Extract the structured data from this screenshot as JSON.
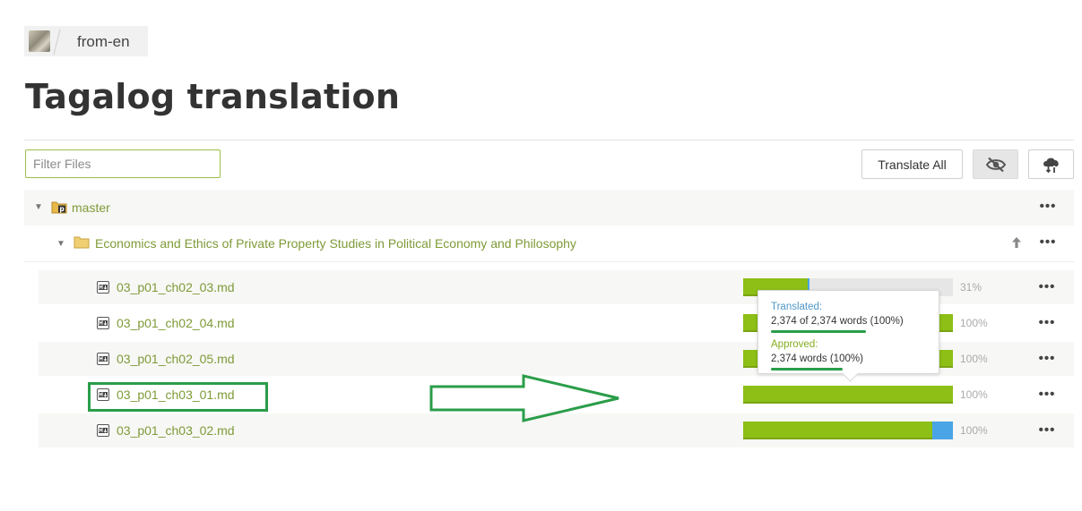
{
  "breadcrumb": {
    "project": "from-en"
  },
  "page": {
    "title": "Tagalog translation"
  },
  "toolbar": {
    "filter_placeholder": "Filter Files",
    "translate_all_label": "Translate All"
  },
  "tree": {
    "branch": {
      "label": "master"
    },
    "folder": {
      "label": "Economics and Ethics of Private Property Studies in Political Economy and Philosophy"
    },
    "files": [
      {
        "name": "03_p01_ch02_03.md",
        "translated_pct": 31,
        "approved_pct": 31,
        "pct_label": "31%"
      },
      {
        "name": "03_p01_ch02_04.md",
        "translated_pct": 100,
        "approved_pct": 100,
        "pct_label": "100%"
      },
      {
        "name": "03_p01_ch02_05.md",
        "translated_pct": 100,
        "approved_pct": 100,
        "pct_label": "100%"
      },
      {
        "name": "03_p01_ch03_01.md",
        "translated_pct": 100,
        "approved_pct": 100,
        "pct_label": "100%"
      },
      {
        "name": "03_p01_ch03_02.md",
        "translated_pct": 100,
        "approved_pct": 90,
        "pct_label": "100%"
      }
    ]
  },
  "tooltip": {
    "translated_label": "Translated:",
    "translated_value": "2,374 of 2,374 words (100%)",
    "approved_label": "Approved:",
    "approved_value": "2,374 words (100%)"
  },
  "colors": {
    "approved": "#8dbf16",
    "translated": "#4aa5e6",
    "link": "#7e9b38",
    "annotation": "#2a9d49"
  }
}
